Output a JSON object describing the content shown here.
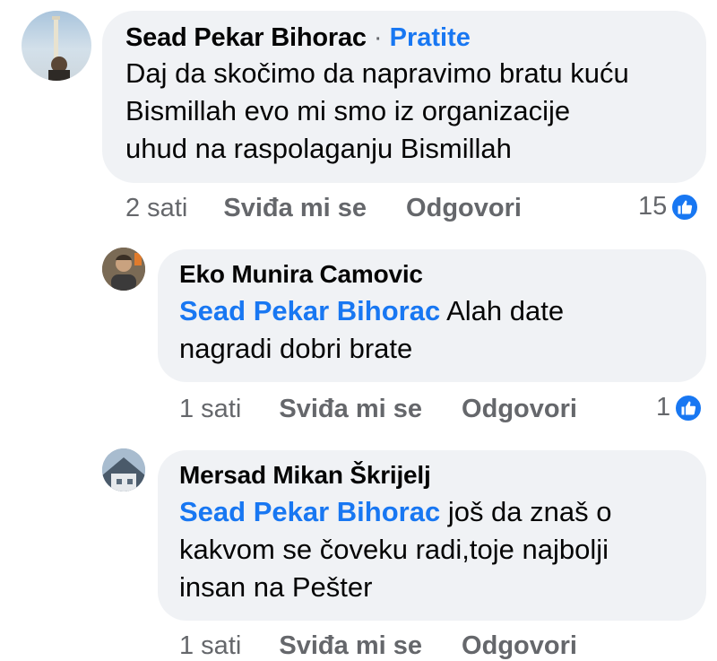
{
  "comments": [
    {
      "author": "Sead Pekar Bihorac",
      "separator": "·",
      "follow_label": "Pratite",
      "text_lines": [
        "Daj da skočimo da napravimo bratu kuću",
        "Bismillah evo mi smo iz organizacije",
        "uhud na raspolaganju Bismillah"
      ],
      "time": "2 sati",
      "like_label": "Sviđa mi se",
      "reply_label": "Odgovori",
      "reaction_count": "15"
    },
    {
      "author": "Eko Munira Camovic",
      "mention": "Sead Pekar Bihorac",
      "text_first": " Alah date",
      "text_second": "nagradi dobri brate",
      "time": "1 sati",
      "like_label": "Sviđa mi se",
      "reply_label": "Odgovori",
      "reaction_count": "1"
    },
    {
      "author": "Mersad Mikan Škrijelj",
      "mention": "Sead Pekar Bihorac",
      "text_first": " još da znaš o",
      "text_second": "kakvom se čoveku radi,toje najbolji",
      "text_third": "insan na Pešter",
      "time": "1 sati",
      "like_label": "Sviđa mi se",
      "reply_label": "Odgovori"
    }
  ],
  "colors": {
    "link": "#1877f2",
    "bubble": "#f0f2f5",
    "muted": "#65676b"
  },
  "icons": {
    "reaction": "like-thumb-icon"
  }
}
